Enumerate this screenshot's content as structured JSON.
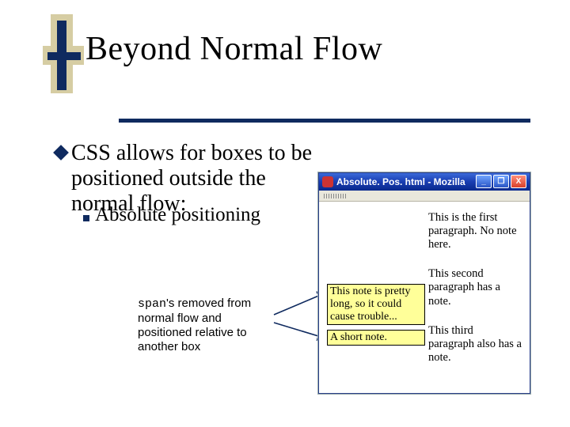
{
  "slide": {
    "title": "Beyond Normal Flow",
    "bullet_main": "CSS allows for boxes to be positioned outside the normal flow:",
    "bullet_sub": "Absolute positioning",
    "caption_prefix": "span",
    "caption_rest": "'s removed from normal flow and positioned relative to another box"
  },
  "browser": {
    "title": "Absolute. Pos. html - Mozilla",
    "min": "_",
    "max": "❐",
    "close": "X",
    "para1": "This is the first paragraph. No note here.",
    "para2": "This second paragraph has a note.",
    "para3": "This third paragraph also has a note.",
    "note1": "This note is pretty long, so it could cause trouble...",
    "note2": "A short note."
  }
}
